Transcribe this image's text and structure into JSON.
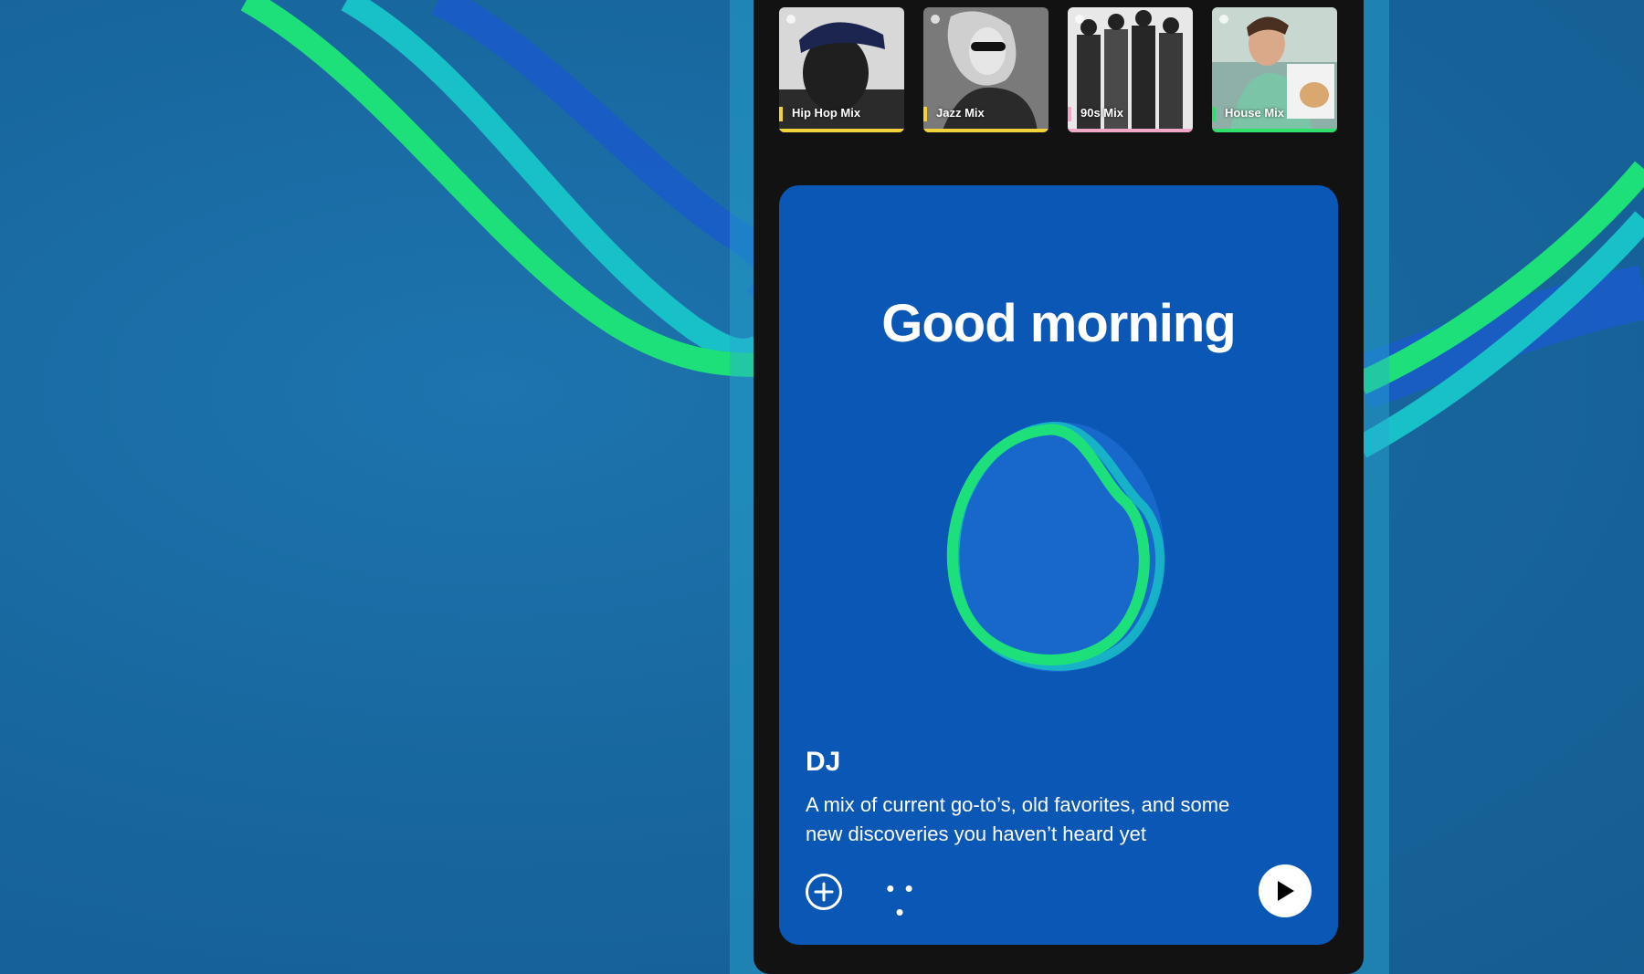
{
  "mixes": [
    {
      "label": "Hip Hop Mix",
      "accent": "#f2d23a",
      "art": "hiphop-portrait"
    },
    {
      "label": "Jazz Mix",
      "accent": "#f2d23a",
      "art": "jazz-portrait"
    },
    {
      "label": "90s Mix",
      "accent": "#f0a8c8",
      "art": "nineties-group"
    },
    {
      "label": "House Mix",
      "accent": "#2fe06a",
      "art": "house-dj"
    }
  ],
  "card": {
    "greeting": "Good morning",
    "title": "DJ",
    "description": "A mix of current go-to’s, old favorites, and some new discoveries you haven’t heard yet",
    "more_label": "• • •"
  },
  "colors": {
    "background": "#1a6aa3",
    "phone": "#121212",
    "card": "#0b57b6",
    "accent_green": "#1ee07a",
    "ribbon_teal": "#18c0c8",
    "ribbon_blue": "#1a5cc8"
  }
}
